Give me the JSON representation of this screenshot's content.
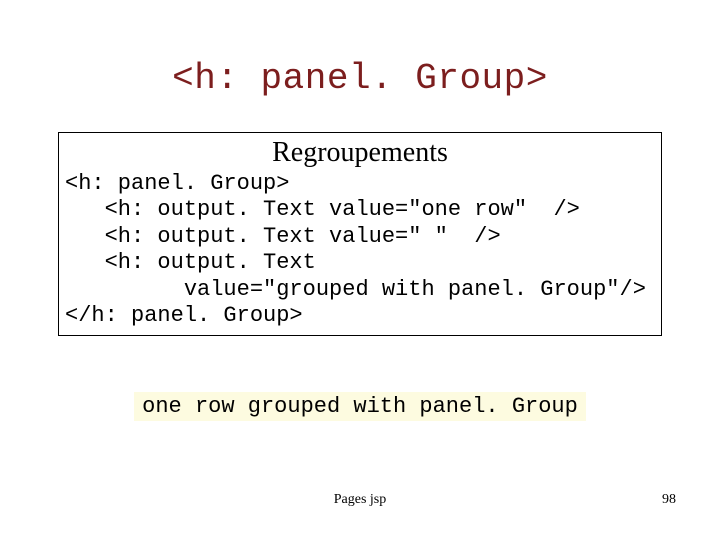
{
  "title": "<h: panel. Group>",
  "box": {
    "heading": "Regroupements",
    "code": "<h: panel. Group>\n   <h: output. Text value=\"one row\"  />\n   <h: output. Text value=\" \"  />\n   <h: output. Text\n         value=\"grouped with panel. Group\"/>\n</h: panel. Group>"
  },
  "output": "one row grouped with panel. Group",
  "footer": {
    "center": "Pages jsp",
    "page": "98"
  }
}
